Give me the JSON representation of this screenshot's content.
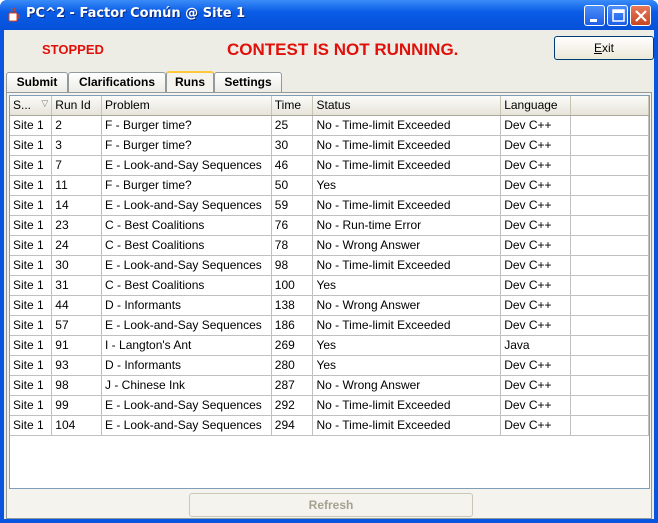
{
  "window": {
    "title": "PC^2 - Factor Común @ Site 1",
    "controls": [
      "minimize-icon",
      "maximize-icon",
      "close-icon"
    ]
  },
  "header": {
    "state": "STOPPED",
    "contest_status": "CONTEST IS NOT RUNNING.",
    "exit_label_underlined": "E",
    "exit_label_rest": "xit"
  },
  "tabs": [
    {
      "label": "Submit"
    },
    {
      "label": "Clarifications"
    },
    {
      "label": "Runs",
      "active": true
    },
    {
      "label": "Settings"
    }
  ],
  "runs_table": {
    "columns": [
      "S...",
      "Run Id",
      "Problem",
      "Time",
      "Status",
      "Language",
      ""
    ],
    "sort_indicator": "▽",
    "rows": [
      [
        "Site 1",
        "2",
        "F - Burger time?",
        "25",
        "No - Time-limit Exceeded",
        "Dev C++"
      ],
      [
        "Site 1",
        "3",
        "F - Burger time?",
        "30",
        "No - Time-limit Exceeded",
        "Dev C++"
      ],
      [
        "Site 1",
        "7",
        "E - Look-and-Say Sequences",
        "46",
        "No - Time-limit Exceeded",
        "Dev C++"
      ],
      [
        "Site 1",
        "11",
        "F - Burger time?",
        "50",
        "Yes",
        "Dev C++"
      ],
      [
        "Site 1",
        "14",
        "E - Look-and-Say Sequences",
        "59",
        "No - Time-limit Exceeded",
        "Dev C++"
      ],
      [
        "Site 1",
        "23",
        "C - Best Coalitions",
        "76",
        "No - Run-time Error",
        "Dev C++"
      ],
      [
        "Site 1",
        "24",
        "C - Best Coalitions",
        "78",
        "No - Wrong Answer",
        "Dev C++"
      ],
      [
        "Site 1",
        "30",
        "E - Look-and-Say Sequences",
        "98",
        "No - Time-limit Exceeded",
        "Dev C++"
      ],
      [
        "Site 1",
        "31",
        "C - Best Coalitions",
        "100",
        "Yes",
        "Dev C++"
      ],
      [
        "Site 1",
        "44",
        "D - Informants",
        "138",
        "No - Wrong Answer",
        "Dev C++"
      ],
      [
        "Site 1",
        "57",
        "E - Look-and-Say Sequences",
        "186",
        "No - Time-limit Exceeded",
        "Dev C++"
      ],
      [
        "Site 1",
        "91",
        "I - Langton's Ant",
        "269",
        "Yes",
        "Java"
      ],
      [
        "Site 1",
        "93",
        "D - Informants",
        "280",
        "Yes",
        "Dev C++"
      ],
      [
        "Site 1",
        "98",
        "J - Chinese Ink",
        "287",
        "No - Wrong Answer",
        "Dev C++"
      ],
      [
        "Site 1",
        "99",
        "E - Look-and-Say Sequences",
        "292",
        "No - Time-limit Exceeded",
        "Dev C++"
      ],
      [
        "Site 1",
        "104",
        "E - Look-and-Say Sequences",
        "294",
        "No - Time-limit Exceeded",
        "Dev C++"
      ]
    ]
  },
  "footer": {
    "refresh_label": "Refresh",
    "refresh_enabled": false
  },
  "colors": {
    "titlebar": "#0a5ce6",
    "status_red": "#e0100b",
    "active_tab_accent": "#ffc83c"
  }
}
